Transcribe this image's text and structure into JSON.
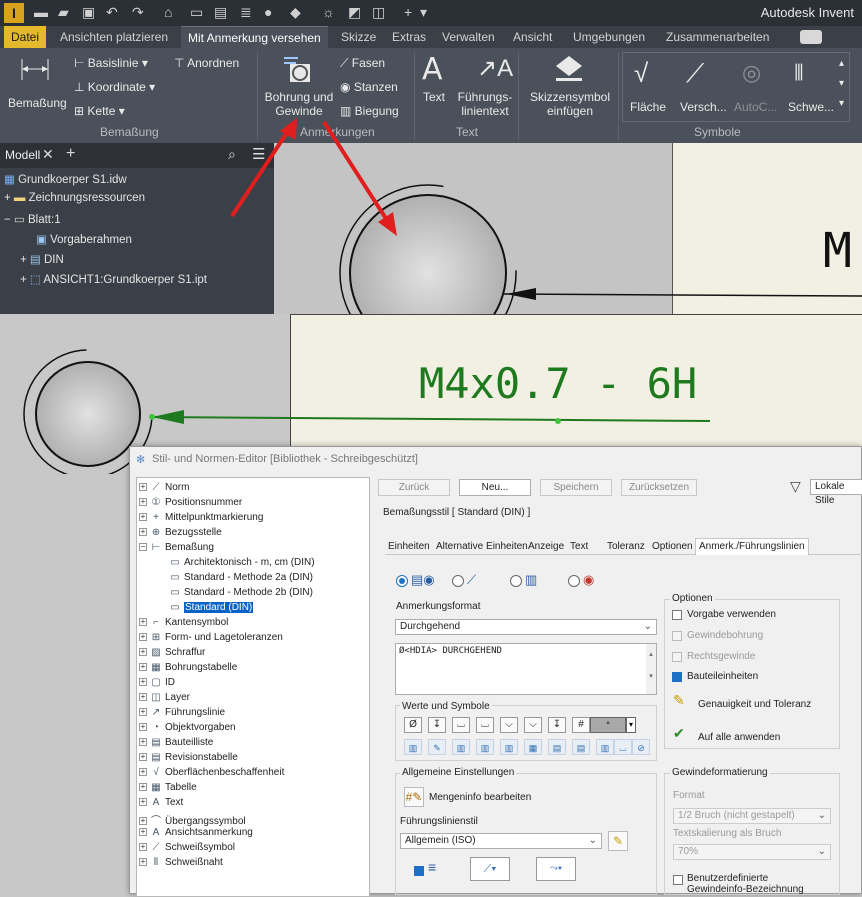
{
  "app": {
    "title": "Autodesk Invent",
    "icon_letter": "I"
  },
  "tabs": [
    "Datei",
    "Ansichten platzieren",
    "Mit Anmerkung versehen",
    "Skizze",
    "Extras",
    "Verwalten",
    "Ansicht",
    "Umgebungen",
    "Zusammenarbeiten"
  ],
  "ribbon": {
    "bemassung": {
      "main": "Bemaßung",
      "items": [
        "Basislinie",
        "Koordinate",
        "Kette"
      ],
      "anordnen": "Anordnen",
      "group": "Bemaßung"
    },
    "anmerkungen": {
      "bohrung": "Bohrung und Gewinde",
      "items": [
        "Fasen",
        "Stanzen",
        "Biegung"
      ],
      "group": "Anmerkungen"
    },
    "text": {
      "text": "Text",
      "fuehrung": "Führungs-linientext",
      "group": "Text"
    },
    "skizze": {
      "label": "Skizzensymbol einfügen"
    },
    "symbole": {
      "items": [
        "Fläche",
        "Versch...",
        "AutoC...",
        "Schwe..."
      ],
      "group": "Symbole"
    }
  },
  "browser": {
    "tab": "Modell",
    "items": [
      "Grundkoerper S1.idw",
      "Zeichnungsressourcen",
      "Blatt:1",
      "Vorgaberahmen",
      "DIN",
      "ANSICHT1:Grundkoerper S1.ipt"
    ]
  },
  "drawing": {
    "label_top": "M",
    "thread_label": "M4x0.7 - 6H"
  },
  "dialog": {
    "title": "Stil- und Normen-Editor [Bibliothek - Schreibgeschützt]",
    "buttons": {
      "zurueck": "Zurück",
      "neu": "Neu...",
      "speichern": "Speichern",
      "zuruecksetzen": "Zurücksetzen"
    },
    "filter": "Lokale Stile",
    "tree": [
      "Norm",
      "Positionsnummer",
      "Mittelpunktmarkierung",
      "Bezugsstelle",
      "Bemaßung",
      "Architektonisch - m, cm (DIN)",
      "Standard - Methode 2a (DIN)",
      "Standard - Methode 2b (DIN)",
      "Standard (DIN)",
      "Kantensymbol",
      "Form- und Lagetoleranzen",
      "Schraffur",
      "Bohrungstabelle",
      "ID",
      "Layer",
      "Führungslinie",
      "Objektvorgaben",
      "Bauteilliste",
      "Revisionstabelle",
      "Oberflächenbeschaffenheit",
      "Tabelle",
      "Text",
      "Übergangssymbol",
      "Ansichtsanmerkung",
      "Schweißsymbol",
      "Schweißnaht"
    ],
    "style_title": "Bemaßungsstil [ Standard (DIN) ]",
    "subtabs": [
      "Einheiten",
      "Alternative Einheiten",
      "Anzeige",
      "Text",
      "Toleranz",
      "Optionen",
      "Anmerk./Führungslinien"
    ],
    "anmerkungsformat": {
      "label": "Anmerkungsformat",
      "value": "Durchgehend",
      "text": "Ø<HDIA> DURCHGEHEND"
    },
    "werte": {
      "label": "Werte und Symbole"
    },
    "allgemein": {
      "label": "Allgemeine Einstellungen",
      "mengeninfo": "Mengeninfo bearbeiten",
      "fuehrungsstil_label": "Führungslinienstil",
      "fuehrungsstil": "Allgemein (ISO)"
    },
    "optionen": {
      "label": "Optionen",
      "vorgabe": "Vorgabe verwenden",
      "gewindebohrung": "Gewindebohrung",
      "rechtsgewinde": "Rechtsgewinde",
      "bauteileinheiten": "Bauteileinheiten",
      "genauigkeit": "Genauigkeit und Toleranz",
      "auf_alle": "Auf alle anwenden"
    },
    "gewinde": {
      "label": "Gewindeformatierung",
      "format_label": "Format",
      "format": "1/2 Bruch (nicht gestapelt)",
      "skal_label": "Textskalierung als Bruch",
      "skal": "70%",
      "benutzer": "Benutzerdefinierte Gewindeinfo-Bezeichnung"
    }
  },
  "colors": {
    "accent": "#e5b92c",
    "annotation_green": "#1f7a1f",
    "arrow_red": "#e01e1e",
    "selection": "#0a64c8"
  }
}
